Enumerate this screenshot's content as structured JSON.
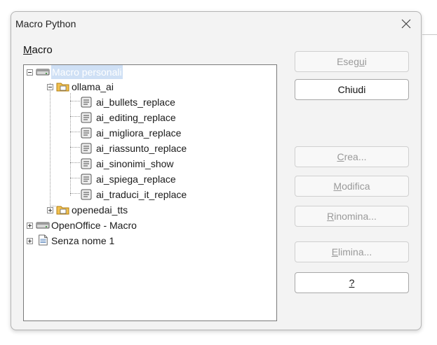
{
  "dialog": {
    "title": "Macro Python",
    "macro_label_u": "M",
    "macro_label_rest": "acro"
  },
  "tree": {
    "root1": "Macro personali",
    "folder1": "ollama_ai",
    "items": [
      "ai_bullets_replace",
      "ai_editing_replace",
      "ai_migliora_replace",
      "ai_riassunto_replace",
      "ai_sinonimi_show",
      "ai_spiega_replace",
      "ai_traduci_it_replace"
    ],
    "folder2": "openedai_tts",
    "root2": "OpenOffice - Macro",
    "root3": "Senza nome 1"
  },
  "buttons": {
    "esegui": {
      "a": "Eseg",
      "u": "u",
      "b": "i"
    },
    "chiudi": {
      "a": "Chiudi",
      "u": "",
      "b": ""
    },
    "crea": {
      "a": "",
      "u": "C",
      "b": "rea..."
    },
    "modifica": {
      "a": "",
      "u": "M",
      "b": "odifica"
    },
    "rinomina": {
      "a": "",
      "u": "R",
      "b": "inomina..."
    },
    "elimina": {
      "a": "",
      "u": "E",
      "b": "limina..."
    },
    "help": {
      "a": "",
      "u": "?",
      "b": ""
    }
  },
  "colors": {
    "selection": "#cfe0f5",
    "dialog_bg": "#f3f3f3",
    "disabled_text": "#9a9a9a"
  }
}
